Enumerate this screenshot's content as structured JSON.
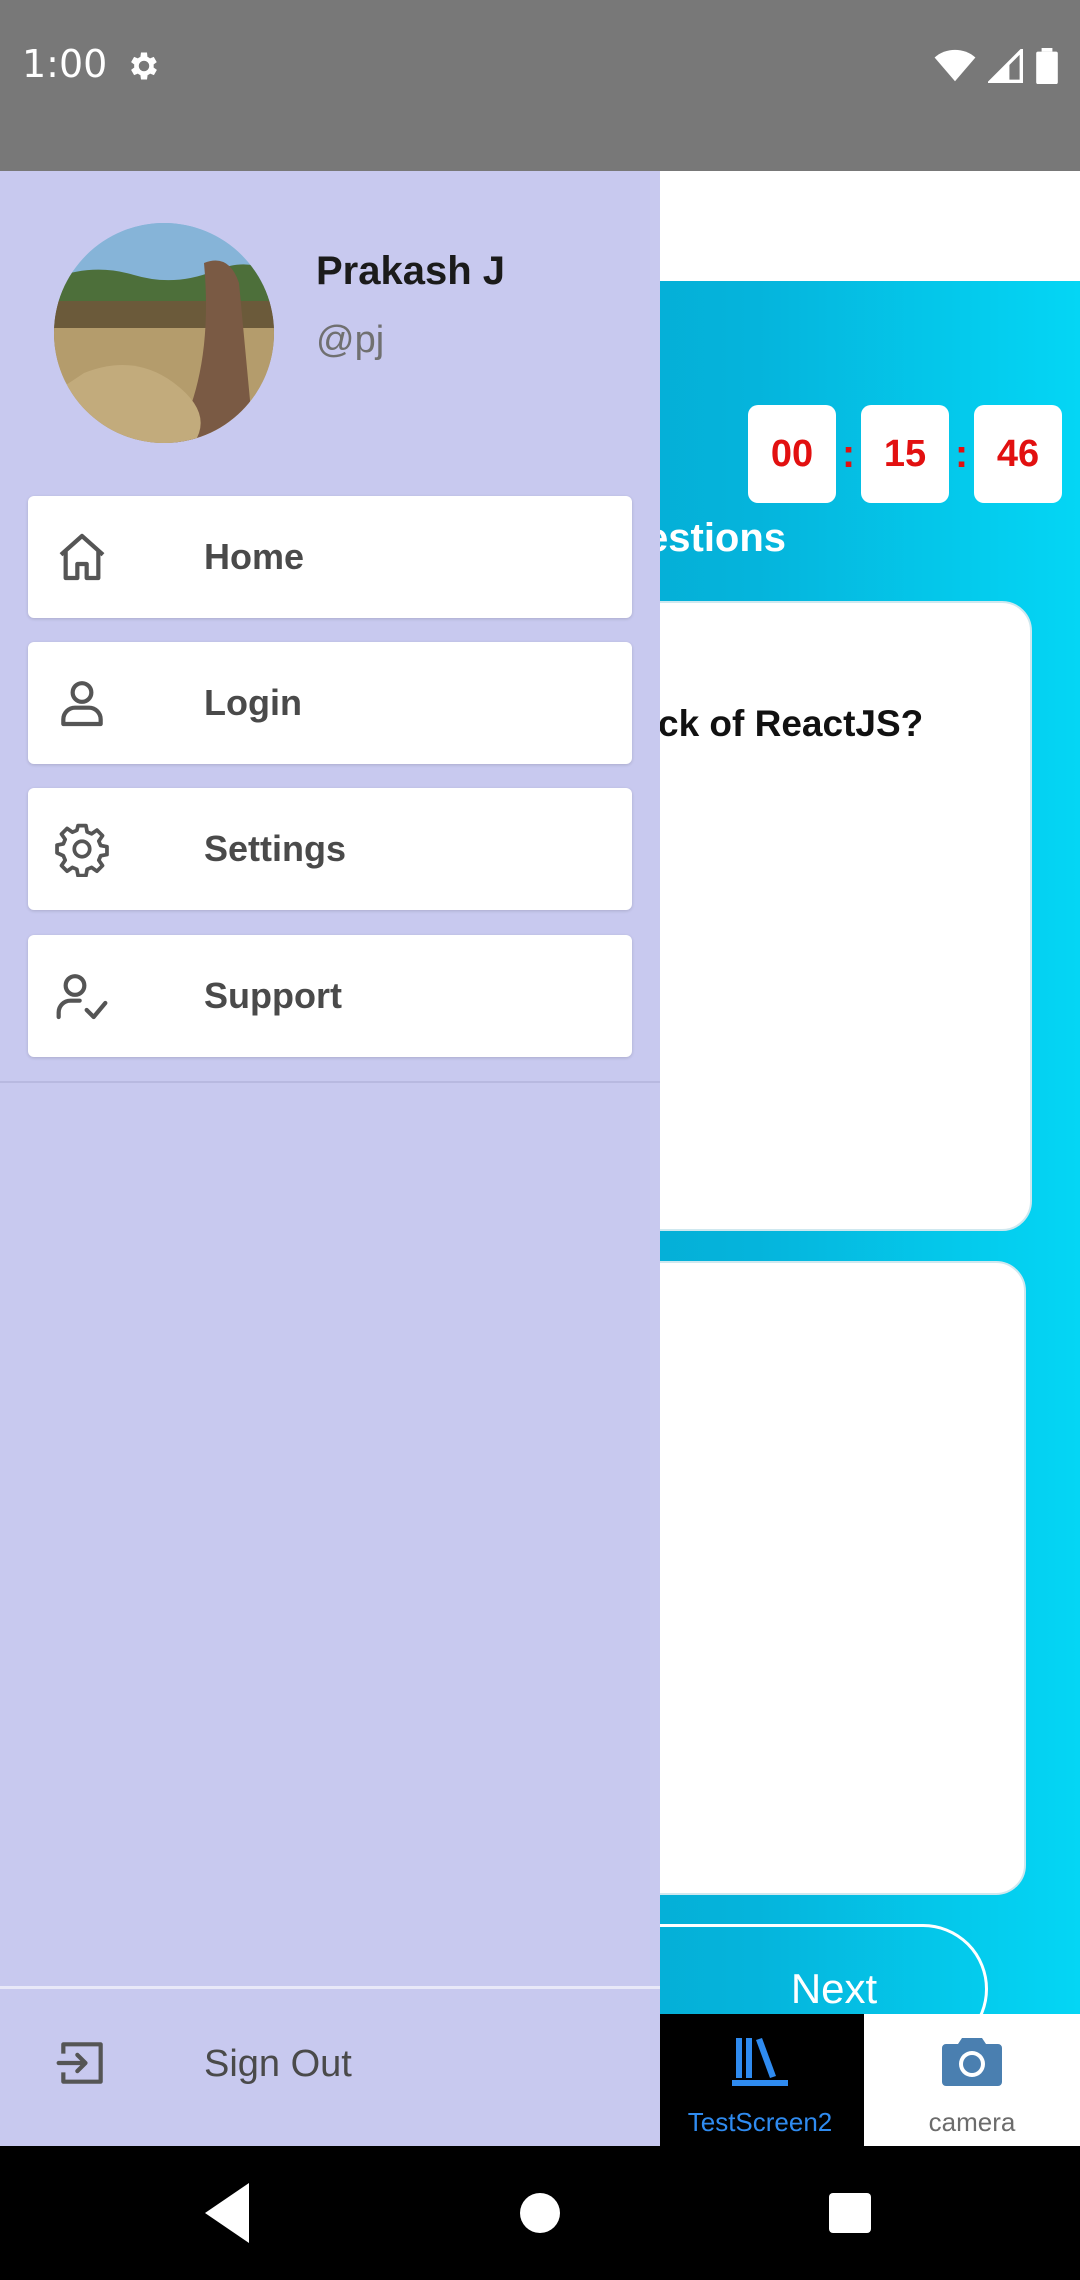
{
  "status_bar": {
    "time": "1:00"
  },
  "drawer": {
    "profile": {
      "name": "Prakash J",
      "handle": "@pj"
    },
    "menu": [
      {
        "label": "Home",
        "icon": "home-icon"
      },
      {
        "label": "Login",
        "icon": "user-icon"
      },
      {
        "label": "Settings",
        "icon": "gear-icon"
      },
      {
        "label": "Support",
        "icon": "user-check-icon"
      }
    ],
    "sign_out": {
      "label": "Sign Out",
      "icon": "sign-out-icon"
    },
    "background_color": "#c8c9ef"
  },
  "screen": {
    "timer": {
      "hours": "00",
      "minutes": "15",
      "seconds": "46",
      "separator": ":"
    },
    "section_title": "estions",
    "question": "ck of ReactJS?",
    "next_label": "Next",
    "accent_timer_color": "#e21010"
  },
  "tabs": [
    {
      "label": "TestScreen2",
      "icon": "library-icon",
      "active": true
    },
    {
      "label": "camera",
      "icon": "camera-icon",
      "active": false
    }
  ],
  "colors": {
    "tab_active": "#2f8bf0",
    "gradient_start": "#0193b8",
    "gradient_end": "#04d6f5"
  }
}
